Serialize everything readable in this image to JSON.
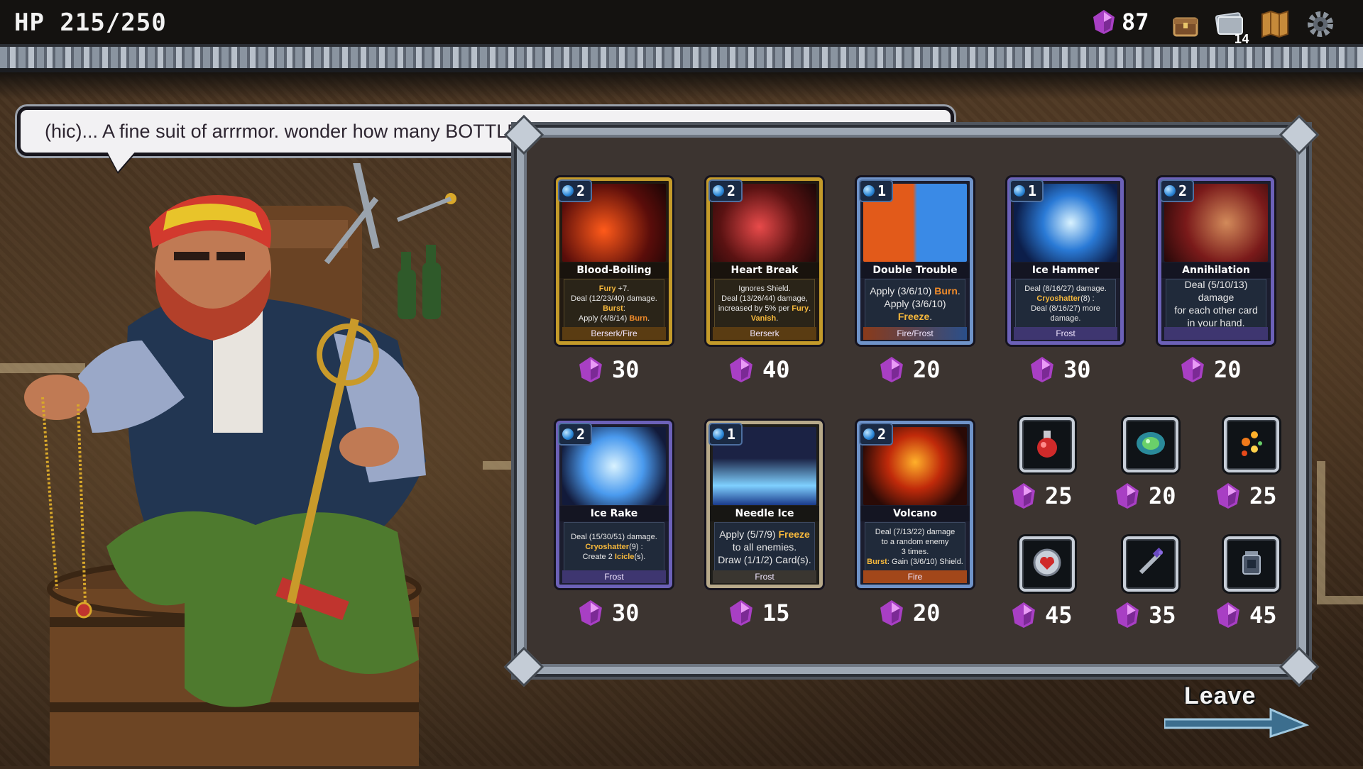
{
  "status": {
    "hp": "HP 215/250"
  },
  "currency": {
    "gems": "87"
  },
  "top_icons": [
    {
      "name": "treasure-chest-icon"
    },
    {
      "name": "card-deck-icon",
      "badge": "14"
    },
    {
      "name": "map-scroll-icon"
    },
    {
      "name": "settings-gear-icon"
    }
  ],
  "dialog": {
    "text": "(hic)... A fine suit of arrrmor. wonder how many BOTTLES that'd fetch... what can i do for YE, m'lord?"
  },
  "cards": [
    {
      "name": "Blood-Boiling Sword",
      "cost": "2",
      "type": "Berserk/Fire",
      "price": "30",
      "desc": [
        [
          "y",
          "Fury"
        ],
        [
          "t",
          " +7."
        ],
        [
          "br"
        ],
        [
          "t",
          "Deal (12/23/40) damage."
        ],
        [
          "br"
        ],
        [
          "y",
          "Burst"
        ],
        [
          "t",
          ":"
        ],
        [
          "br"
        ],
        [
          "t",
          "Apply (4/8/14) "
        ],
        [
          "o",
          "Burn"
        ],
        [
          "t",
          "."
        ]
      ]
    },
    {
      "name": "Heart Break",
      "cost": "2",
      "type": "Berserk",
      "price": "40",
      "desc": [
        [
          "t",
          "Ignores Shield."
        ],
        [
          "br"
        ],
        [
          "t",
          "Deal (13/26/44) damage,"
        ],
        [
          "br"
        ],
        [
          "t",
          "increased by 5% per "
        ],
        [
          "y",
          "Fury"
        ],
        [
          "t",
          "."
        ],
        [
          "br"
        ],
        [
          "y",
          "Vanish"
        ],
        [
          "t",
          "."
        ]
      ]
    },
    {
      "name": "Double Trouble",
      "cost": "1",
      "type": "Fire/Frost",
      "price": "20",
      "desc": [
        [
          "t",
          "Apply (3/6/10) "
        ],
        [
          "o",
          "Burn"
        ],
        [
          "t",
          "."
        ],
        [
          "br"
        ],
        [
          "t",
          "Apply (3/6/10)"
        ],
        [
          "br"
        ],
        [
          "y",
          "Freeze"
        ],
        [
          "t",
          "."
        ]
      ]
    },
    {
      "name": "Ice Hammer",
      "cost": "1",
      "type": "Frost",
      "price": "30",
      "desc": [
        [
          "t",
          "Deal (8/16/27) damage."
        ],
        [
          "br"
        ],
        [
          "y",
          "Cryoshatter"
        ],
        [
          "t",
          "(8) :"
        ],
        [
          "br"
        ],
        [
          "t",
          "Deal (8/16/27) more"
        ],
        [
          "br"
        ],
        [
          "t",
          "damage."
        ]
      ]
    },
    {
      "name": "Annihilation",
      "cost": "2",
      "type": "",
      "price": "20",
      "desc": [
        [
          "t",
          "Deal (5/10/13) damage"
        ],
        [
          "br"
        ],
        [
          "t",
          "for each other card"
        ],
        [
          "br"
        ],
        [
          "t",
          "in your hand."
        ]
      ]
    },
    {
      "name": "Ice Rake",
      "cost": "2",
      "type": "Frost",
      "price": "30",
      "desc": [
        [
          "t",
          "Deal (15/30/51) damage."
        ],
        [
          "br"
        ],
        [
          "y",
          "Cryoshatter"
        ],
        [
          "t",
          "(9) :"
        ],
        [
          "br"
        ],
        [
          "t",
          "Create 2 "
        ],
        [
          "y",
          "Icicle"
        ],
        [
          "t",
          "(s)."
        ]
      ]
    },
    {
      "name": "Needle Ice",
      "cost": "1",
      "type": "Frost",
      "price": "15",
      "desc": [
        [
          "t",
          "Apply (5/7/9) "
        ],
        [
          "y",
          "Freeze"
        ],
        [
          "br"
        ],
        [
          "t",
          "to all enemies."
        ],
        [
          "br"
        ],
        [
          "t",
          "Draw (1/1/2) Card(s)."
        ]
      ]
    },
    {
      "name": "Volcano",
      "cost": "2",
      "type": "Fire",
      "price": "20",
      "desc": [
        [
          "t",
          "Deal (7/13/22) damage"
        ],
        [
          "br"
        ],
        [
          "t",
          "to a random enemy"
        ],
        [
          "br"
        ],
        [
          "t",
          "3 times."
        ],
        [
          "br"
        ],
        [
          "y",
          "Burst"
        ],
        [
          "t",
          ": Gain (3/6/10) Shield."
        ]
      ]
    }
  ],
  "relics": [
    {
      "name": "red-potion-icon",
      "price": "25"
    },
    {
      "name": "green-gem-icon",
      "price": "20"
    },
    {
      "name": "fire-sparks-icon",
      "price": "25"
    },
    {
      "name": "heart-orb-icon",
      "price": "45"
    },
    {
      "name": "dagger-icon",
      "price": "35"
    },
    {
      "name": "lantern-icon",
      "price": "45"
    }
  ],
  "actions": {
    "leave": "Leave"
  },
  "colors": {
    "accent_gem": "#c04ed8",
    "keyword_yellow": "#f6b83c",
    "keyword_orange": "#f28c2a",
    "panel_bg": "#3c3430",
    "frame": "#9ea8b4"
  }
}
